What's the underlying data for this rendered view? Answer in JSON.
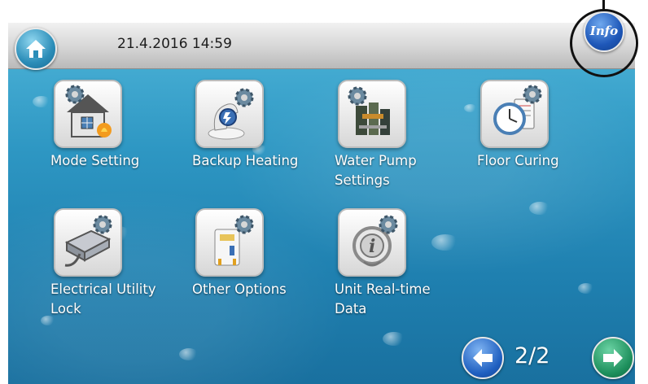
{
  "header": {
    "datetime": "21.4.2016 14:59",
    "home_icon": "home-icon",
    "info_label": "Info"
  },
  "menu": {
    "items": [
      {
        "label": "Mode Setting",
        "icon": "mode-setting-icon"
      },
      {
        "label": "Backup Heating",
        "icon": "backup-heating-icon"
      },
      {
        "label": "Water Pump Settings",
        "icon": "water-pump-icon"
      },
      {
        "label": "Floor Curing",
        "icon": "floor-curing-icon"
      },
      {
        "label": "Electrical Utility Lock",
        "icon": "electrical-utility-lock-icon"
      },
      {
        "label": "Other Options",
        "icon": "other-options-icon"
      },
      {
        "label": "Unit Real-time Data",
        "icon": "unit-realtime-data-icon"
      }
    ]
  },
  "pagination": {
    "page": "2/2",
    "prev_icon": "arrow-left-icon",
    "next_icon": "arrow-right-icon"
  },
  "colors": {
    "background": "#2e97c3",
    "top_bar": "#d5d5d5",
    "info_button": "#1e57b8",
    "next_button": "#1d8f5c"
  }
}
